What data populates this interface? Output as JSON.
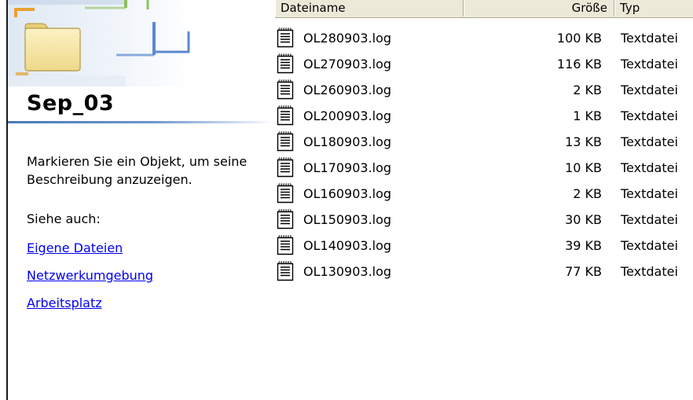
{
  "folder": {
    "title": "Sep_03",
    "description": "Markieren Sie ein Objekt, um seine Beschreibung anzuzeigen.",
    "see_also_label": "Siehe auch:",
    "links": [
      "Eigene Dateien",
      "Netzwerkumgebung",
      "Arbeitsplatz"
    ]
  },
  "list": {
    "columns": {
      "name": "Dateiname",
      "size": "Größe",
      "type": "Typ"
    },
    "rows": [
      {
        "name": "OL280903.log",
        "size": "100 KB",
        "type": "Textdatei"
      },
      {
        "name": "OL270903.log",
        "size": "116 KB",
        "type": "Textdatei"
      },
      {
        "name": "OL260903.log",
        "size": "2 KB",
        "type": "Textdatei"
      },
      {
        "name": "OL200903.log",
        "size": "1 KB",
        "type": "Textdatei"
      },
      {
        "name": "OL180903.log",
        "size": "13 KB",
        "type": "Textdatei"
      },
      {
        "name": "OL170903.log",
        "size": "10 KB",
        "type": "Textdatei"
      },
      {
        "name": "OL160903.log",
        "size": "2 KB",
        "type": "Textdatei"
      },
      {
        "name": "OL150903.log",
        "size": "30 KB",
        "type": "Textdatei"
      },
      {
        "name": "OL140903.log",
        "size": "39 KB",
        "type": "Textdatei"
      },
      {
        "name": "OL130903.log",
        "size": "77 KB",
        "type": "Textdatei"
      }
    ]
  },
  "icons": {
    "folder": "folder-icon",
    "file": "text-file-icon"
  },
  "colors": {
    "link": "#0000ee",
    "header_bg": "#ece9d8",
    "rule_blue": "#4a78b8",
    "folder_yellow": "#f8e9a0",
    "accent_orange": "#e8a030",
    "accent_green": "#8cc060",
    "accent_blue": "#5a8ad0"
  }
}
